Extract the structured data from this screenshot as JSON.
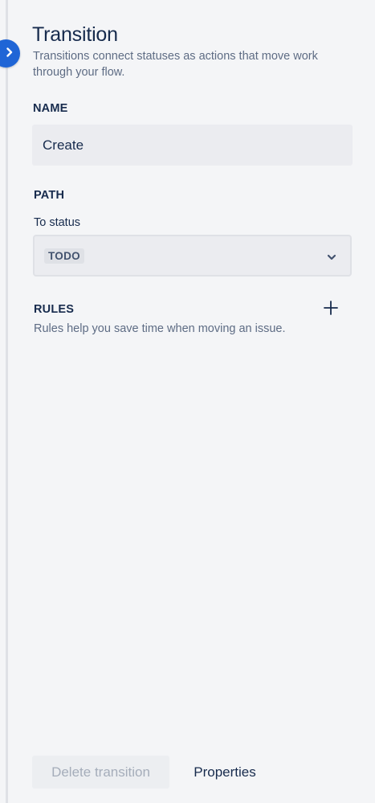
{
  "panel": {
    "title": "Transition",
    "subtitle": "Transitions connect statuses as actions that move work through your flow."
  },
  "name_section": {
    "label": "NAME",
    "value": "Create"
  },
  "path_section": {
    "label": "PATH",
    "to_status_label": "To status",
    "to_status_value": "TODO"
  },
  "rules_section": {
    "label": "RULES",
    "help_text": "Rules help you save time when moving an issue."
  },
  "footer": {
    "delete_label": "Delete transition",
    "properties_label": "Properties"
  },
  "icons": {
    "collapse": "chevron-right-icon",
    "select": "chevron-down-icon",
    "add_rule": "plus-icon"
  },
  "colors": {
    "accent": "#1f65d6",
    "text": "#172b4d",
    "subtle_text": "#5e6c84",
    "panel_bg": "#f4f5f7"
  }
}
